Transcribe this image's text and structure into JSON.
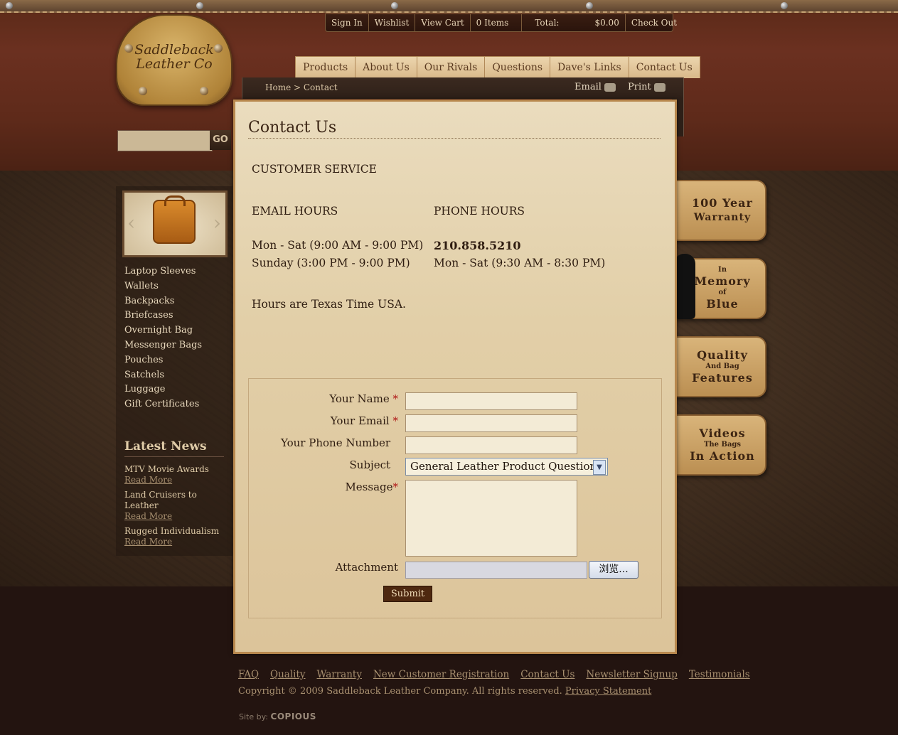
{
  "brand": {
    "logo_text": "Saddleback Leather Co"
  },
  "topbar": {
    "sign_in": "Sign In",
    "wishlist": "Wishlist",
    "view_cart": "View Cart",
    "items": "0 Items",
    "total_label": "Total:",
    "total_value": "$0.00",
    "checkout": "Check Out"
  },
  "nav": [
    "Products",
    "About Us",
    "Our Rivals",
    "Questions",
    "Dave's Links",
    "Contact Us"
  ],
  "breadcrumb": {
    "home": "Home",
    "separator": " > ",
    "current": "Contact"
  },
  "utility": {
    "email": "Email",
    "print": "Print"
  },
  "search": {
    "go": "GO",
    "value": ""
  },
  "sidebar": {
    "categories": [
      "Laptop Sleeves",
      "Wallets",
      "Backpacks",
      "Briefcases",
      "Overnight Bag",
      "Messenger Bags",
      "Pouches",
      "Satchels",
      "Luggage",
      "Gift Certificates"
    ],
    "news_title": "Latest News",
    "news": [
      {
        "title": "MTV Movie Awards",
        "more": "Read More"
      },
      {
        "title": "Land Cruisers to Leather",
        "more": "Read More"
      },
      {
        "title": "Rugged Individualism",
        "more": "Read More"
      }
    ]
  },
  "badges": [
    {
      "lines": [
        "100 Year",
        "Warranty"
      ]
    },
    {
      "lines": [
        "In",
        "Memory",
        "of",
        "Blue"
      ]
    },
    {
      "lines": [
        "Quality",
        "And Bag",
        "Features"
      ]
    },
    {
      "lines": [
        "Videos",
        "The Bags",
        "In Action"
      ]
    }
  ],
  "main": {
    "title": "Contact Us",
    "customer_service": "CUSTOMER SERVICE",
    "email_hours_title": "EMAIL HOURS",
    "email_hours": [
      "Mon - Sat (9:00 AM - 9:00 PM)",
      "Sunday (3:00 PM - 9:00 PM)"
    ],
    "phone_hours_title": "PHONE HOURS",
    "phone": "210.858.5210",
    "phone_hours": "Mon - Sat (9:30 AM - 8:30 PM)",
    "timezone_note": "Hours are Texas Time USA."
  },
  "form": {
    "name_label": "Your Name",
    "email_label": "Your Email",
    "phone_label": "Your Phone Number",
    "subject_label": "Subject",
    "subject_value": "General Leather Product Questions",
    "message_label": "Message",
    "attachment_label": "Attachment",
    "browse": "浏览...",
    "submit": "Submit",
    "required_mark": "*"
  },
  "footer": {
    "links": [
      "FAQ",
      "Quality",
      "Warranty",
      "New Customer Registration",
      "Contact Us",
      "Newsletter Signup",
      "Testimonials"
    ],
    "copyright": "Copyright © 2009 Saddleback Leather Company. All rights reserved.",
    "privacy": "Privacy Statement",
    "site_by": "Site by:",
    "site_by_brand": "COPIOUS"
  }
}
